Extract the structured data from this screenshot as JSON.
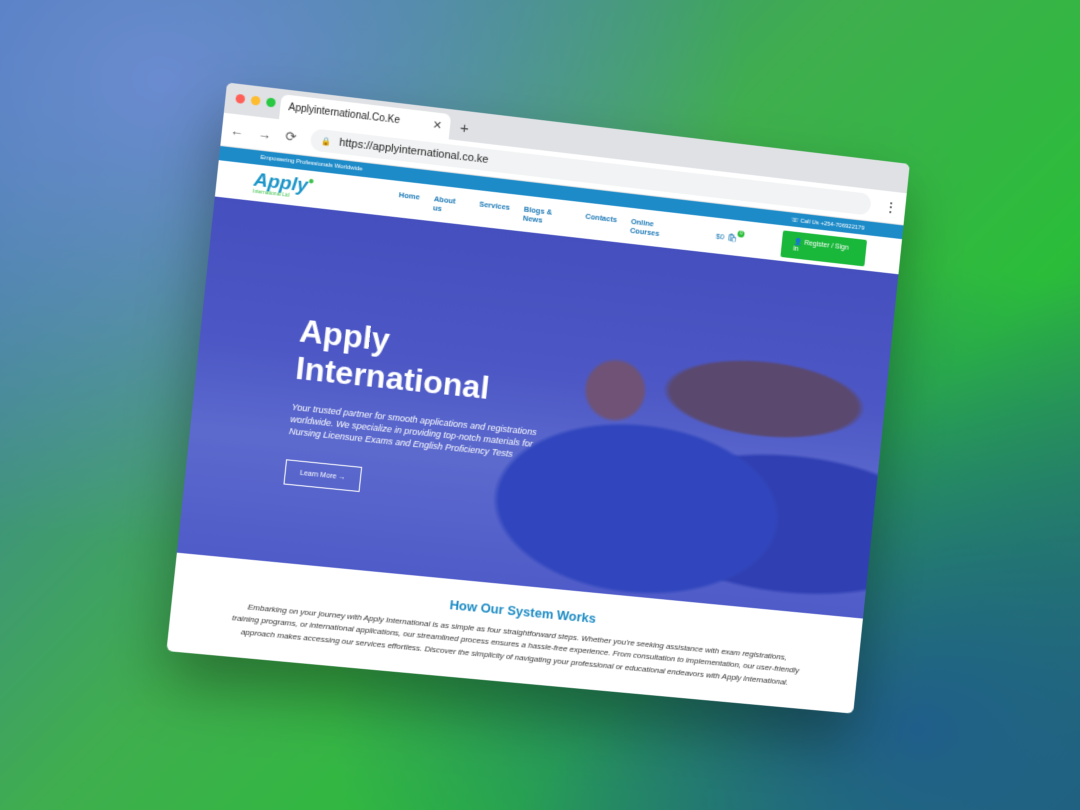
{
  "browser": {
    "tab_title": "Applyinternational.Co.Ke",
    "tab_close": "✕",
    "new_tab": "+",
    "back": "←",
    "forward": "→",
    "reload": "⟳",
    "lock": "🔒",
    "url": "https://applyinternational.co.ke",
    "menu": "⋮"
  },
  "topbar": {
    "tagline": "Empowering Professionals Worldwide",
    "phone": "Call Us +254-706922179"
  },
  "nav": {
    "logo": "Apply",
    "logo_sub": "International Ltd",
    "links": [
      "Home",
      "About us",
      "Services",
      "Blogs & News",
      "Contacts",
      "Online Courses"
    ],
    "cart_total": "$0",
    "cart_count": "0",
    "register": "Register / Sign in"
  },
  "hero": {
    "title_line1": "Apply",
    "title_line2": "International",
    "description": "Your trusted partner for smooth applications and registrations worldwide. We specialize in providing top-notch materials for Nursing Licensure Exams and English Proficiency Tests",
    "cta": "Learn More →"
  },
  "how": {
    "heading": "How Our System Works",
    "body": "Embarking on your journey with Apply International is as simple as four straightforward steps. Whether you're seeking assistance with exam registrations, training programs, or international applications, our streamlined process ensures a hassle-free experience. From consultation to implementation, our user-friendly approach makes accessing our services effortless. Discover the simplicity of navigating your professional or educational endeavors with Apply International."
  },
  "colors": {
    "brand_blue": "#1b95c8",
    "brand_green": "#19b83a"
  }
}
